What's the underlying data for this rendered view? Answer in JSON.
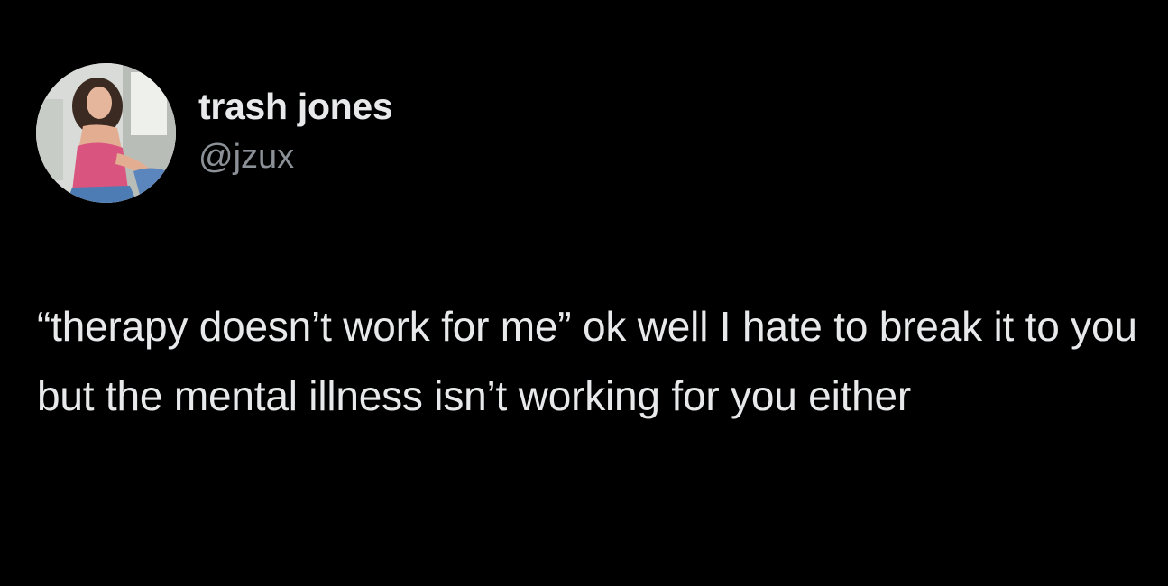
{
  "author": {
    "display_name": "trash jones",
    "handle": "@jzux"
  },
  "tweet": {
    "text": "“therapy doesn’t work for me” ok well I hate to break it to you but the mental illness isn’t working for you either"
  },
  "colors": {
    "background": "#000000",
    "primary_text": "#e7e9ea",
    "secondary_text": "#8b9197"
  },
  "icons": {
    "avatar": "profile-photo"
  }
}
